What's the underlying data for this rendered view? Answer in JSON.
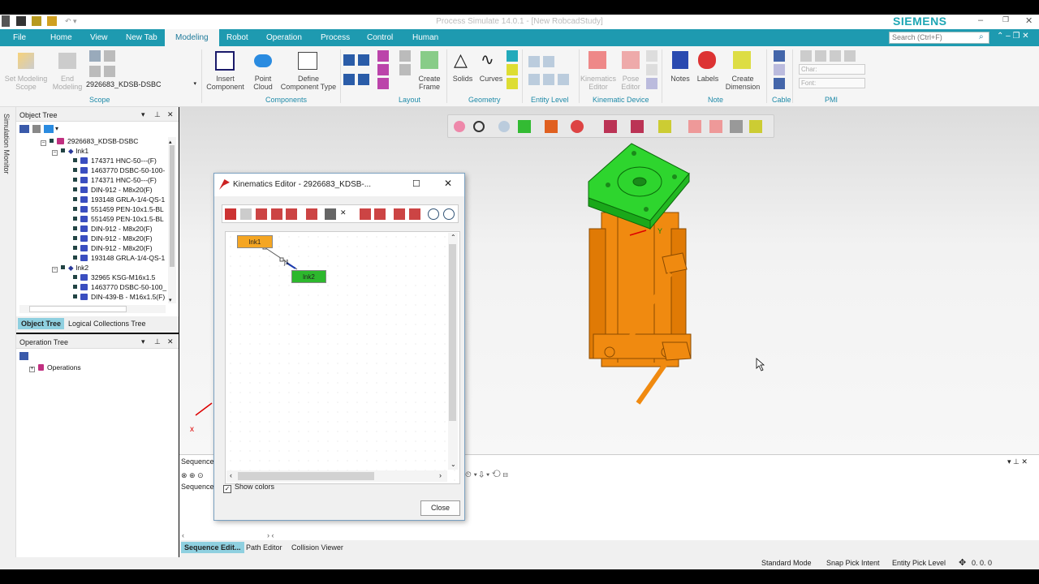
{
  "app": {
    "title": "Process Simulate 14.0.1 - [New RobcadStudy]",
    "brand": "SIEMENS"
  },
  "tabs": [
    "File",
    "Home",
    "View",
    "New Tab",
    "Modeling",
    "Robot",
    "Operation",
    "Process",
    "Control",
    "Human"
  ],
  "active_tab": "Modeling",
  "search_placeholder": "Search (Ctrl+F)",
  "ribbon": {
    "scope": {
      "set_modeling": "Set Modeling Scope",
      "end_modeling": "End Modeling",
      "dropdown": "2926683_KDSB-DSBC",
      "group": "Scope"
    },
    "components": {
      "insert": "Insert Component",
      "point_cloud": "Point Cloud",
      "define": "Define Component Type",
      "group": "Components"
    },
    "layout": {
      "create_frame": "Create Frame",
      "group": "Layout"
    },
    "geometry": {
      "solids": "Solids",
      "curves": "Curves",
      "group": "Geometry"
    },
    "entity": {
      "group": "Entity Level"
    },
    "kinematic": {
      "editor": "Kinematics Editor",
      "pose": "Pose Editor",
      "group": "Kinematic Device"
    },
    "note": {
      "notes": "Notes",
      "labels": "Labels",
      "create_dim": "Create Dimension",
      "group": "Note"
    },
    "cable": {
      "group": "Cable"
    },
    "pmi": {
      "char": "Char:",
      "font": "Font:",
      "group": "PMI"
    }
  },
  "side": {
    "simulation_monitor": "Simulation Monitor"
  },
  "object_tree": {
    "title": "Object Tree",
    "root": "2926683_KDSB-DSBC",
    "lnk1": "lnk1",
    "lnk1_items": [
      "174371 HNC-50---(F)",
      "1463770 DSBC-50-100-",
      "174371 HNC-50---(F)",
      "DIN-912 - M8x20(F)",
      "193148 GRLA-1/4-QS-1",
      "551459 PEN-10x1.5-BL",
      "551459 PEN-10x1.5-BL",
      "DIN-912 - M8x20(F)",
      "DIN-912 - M8x20(F)",
      "DIN-912 - M8x20(F)",
      "193148 GRLA-1/4-QS-1"
    ],
    "lnk2": "lnk2",
    "lnk2_items": [
      "32965 KSG-M16x1.5",
      "1463770 DSBC-50-100_",
      "DIN-439-B - M16x1.5(F)"
    ]
  },
  "left_tabs": {
    "object_tree": "Object Tree",
    "logical": "Logical Collections Tree"
  },
  "operation_tree": {
    "title": "Operation Tree",
    "operations": "Operations"
  },
  "sequence": {
    "title": "Sequence",
    "sub": "Sequence"
  },
  "bottom_tabs": {
    "seq_edit": "Sequence Edit...",
    "path": "Path Editor",
    "collision": "Collision Viewer"
  },
  "status": {
    "mode": "Standard Mode",
    "snap": "Snap Pick Intent",
    "entity": "Entity Pick Level",
    "coords": "0. 0. 0"
  },
  "dialog": {
    "title": "Kinematics Editor - 2926683_KDSB-...",
    "node1": "lnk1",
    "node2": "lnk2",
    "joint": "j1",
    "show_colors": "Show colors",
    "close": "Close"
  },
  "colors": {
    "ribbon_tab_bg": "#1e9ab0",
    "node1": "#f5a623",
    "node2": "#2db82d",
    "part_orange": "#f08a10",
    "part_green": "#2ed52e"
  }
}
